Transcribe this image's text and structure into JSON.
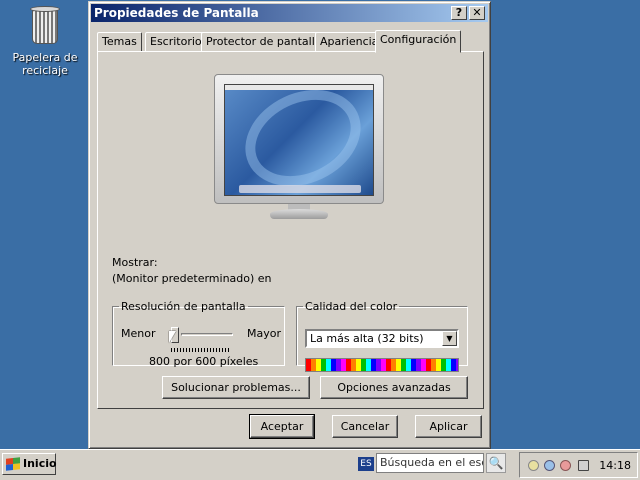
{
  "desktop": {
    "recycle_bin_label_1": "Papelera de",
    "recycle_bin_label_2": "reciclaje"
  },
  "window": {
    "title": "Propiedades de Pantalla",
    "help_label": "?",
    "close_label": "✕",
    "tabs": [
      {
        "label": "Temas"
      },
      {
        "label": "Escritorio"
      },
      {
        "label": "Protector de pantalla"
      },
      {
        "label": "Apariencia"
      },
      {
        "label": "Configuración",
        "active": true
      }
    ],
    "display_label": "Mostrar:",
    "monitor_label": "(Monitor predeterminado) en",
    "resolution": {
      "legend": "Resolución de pantalla",
      "less": "Menor",
      "more": "Mayor",
      "value": "800 por 600 píxeles",
      "slider_position": 0.15
    },
    "color": {
      "legend": "Calidad del color",
      "selected": "La más alta (32 bits)"
    },
    "troubleshoot_button": "Solucionar problemas...",
    "advanced_button": "Opciones avanzadas",
    "ok_button": "Aceptar",
    "cancel_button": "Cancelar",
    "apply_button": "Aplicar"
  },
  "taskbar": {
    "start_label": "Inicio",
    "language": "ES",
    "search_placeholder": "Búsqueda en el escrito",
    "clock": "14:18"
  },
  "colors": {
    "desktop": "#3a6ea5",
    "titlebar_start": "#0a246a",
    "titlebar_end": "#a6caf0",
    "face": "#d4d0c8"
  }
}
